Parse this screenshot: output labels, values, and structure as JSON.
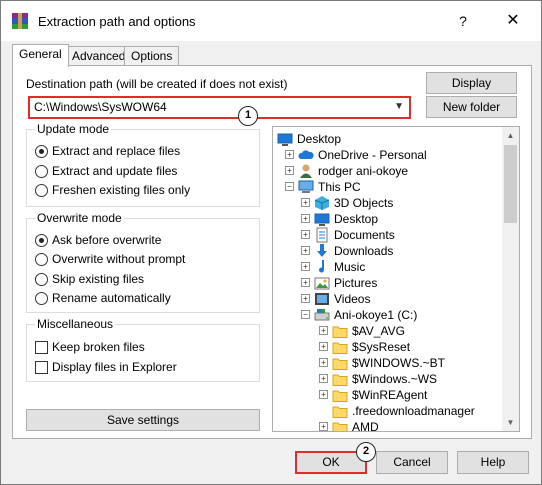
{
  "window": {
    "title": "Extraction path and options",
    "help_label": "?",
    "close_label": "✕"
  },
  "tabs": [
    {
      "label": "General"
    },
    {
      "label": "Advanced"
    },
    {
      "label": "Options"
    }
  ],
  "destination": {
    "label": "Destination path (will be created if does not exist)",
    "value": "C:\\Windows\\SysWOW64",
    "badge": "1"
  },
  "buttons": {
    "display": "Display",
    "new_folder": "New folder",
    "save_settings": "Save settings",
    "ok": "OK",
    "ok_badge": "2",
    "cancel": "Cancel",
    "help": "Help"
  },
  "update_mode": {
    "title": "Update mode",
    "options": [
      {
        "label": "Extract and replace files",
        "selected": true
      },
      {
        "label": "Extract and update files",
        "selected": false
      },
      {
        "label": "Freshen existing files only",
        "selected": false
      }
    ]
  },
  "overwrite_mode": {
    "title": "Overwrite mode",
    "options": [
      {
        "label": "Ask before overwrite",
        "selected": true
      },
      {
        "label": "Overwrite without prompt",
        "selected": false
      },
      {
        "label": "Skip existing files",
        "selected": false
      },
      {
        "label": "Rename automatically",
        "selected": false
      }
    ]
  },
  "misc": {
    "title": "Miscellaneous",
    "options": [
      {
        "label": "Keep broken files",
        "checked": false
      },
      {
        "label": "Display files in Explorer",
        "checked": false
      }
    ]
  },
  "tree": [
    {
      "label": "Desktop",
      "icon": "desktop-icon",
      "level": 0,
      "expander": "none"
    },
    {
      "label": "OneDrive - Personal",
      "icon": "cloud-icon",
      "level": 1,
      "expander": "plus"
    },
    {
      "label": "rodger ani-okoye",
      "icon": "user-icon",
      "level": 1,
      "expander": "plus"
    },
    {
      "label": "This PC",
      "icon": "computer-icon",
      "level": 1,
      "expander": "minus"
    },
    {
      "label": "3D Objects",
      "icon": "cube-icon",
      "level": 2,
      "expander": "plus"
    },
    {
      "label": "Desktop",
      "icon": "desktop-icon",
      "level": 2,
      "expander": "plus"
    },
    {
      "label": "Documents",
      "icon": "document-icon",
      "level": 2,
      "expander": "plus"
    },
    {
      "label": "Downloads",
      "icon": "download-icon",
      "level": 2,
      "expander": "plus"
    },
    {
      "label": "Music",
      "icon": "music-icon",
      "level": 2,
      "expander": "plus"
    },
    {
      "label": "Pictures",
      "icon": "picture-icon",
      "level": 2,
      "expander": "plus"
    },
    {
      "label": "Videos",
      "icon": "video-icon",
      "level": 2,
      "expander": "plus"
    },
    {
      "label": "Ani-okoye1 (C:)",
      "icon": "drive-icon",
      "level": 2,
      "expander": "minus"
    },
    {
      "label": "$AV_AVG",
      "icon": "folder-icon",
      "level": 3,
      "expander": "plus"
    },
    {
      "label": "$SysReset",
      "icon": "folder-icon",
      "level": 3,
      "expander": "plus"
    },
    {
      "label": "$WINDOWS.~BT",
      "icon": "folder-icon",
      "level": 3,
      "expander": "plus"
    },
    {
      "label": "$Windows.~WS",
      "icon": "folder-icon",
      "level": 3,
      "expander": "plus"
    },
    {
      "label": "$WinREAgent",
      "icon": "folder-icon",
      "level": 3,
      "expander": "plus"
    },
    {
      "label": ".freedownloadmanager",
      "icon": "folder-icon",
      "level": 3,
      "expander": "none"
    },
    {
      "label": "AMD",
      "icon": "folder-icon",
      "level": 3,
      "expander": "plus"
    }
  ],
  "colors": {
    "highlight": "#e32b2b",
    "folder": "#ffd866",
    "accent": "#1e78d7"
  }
}
